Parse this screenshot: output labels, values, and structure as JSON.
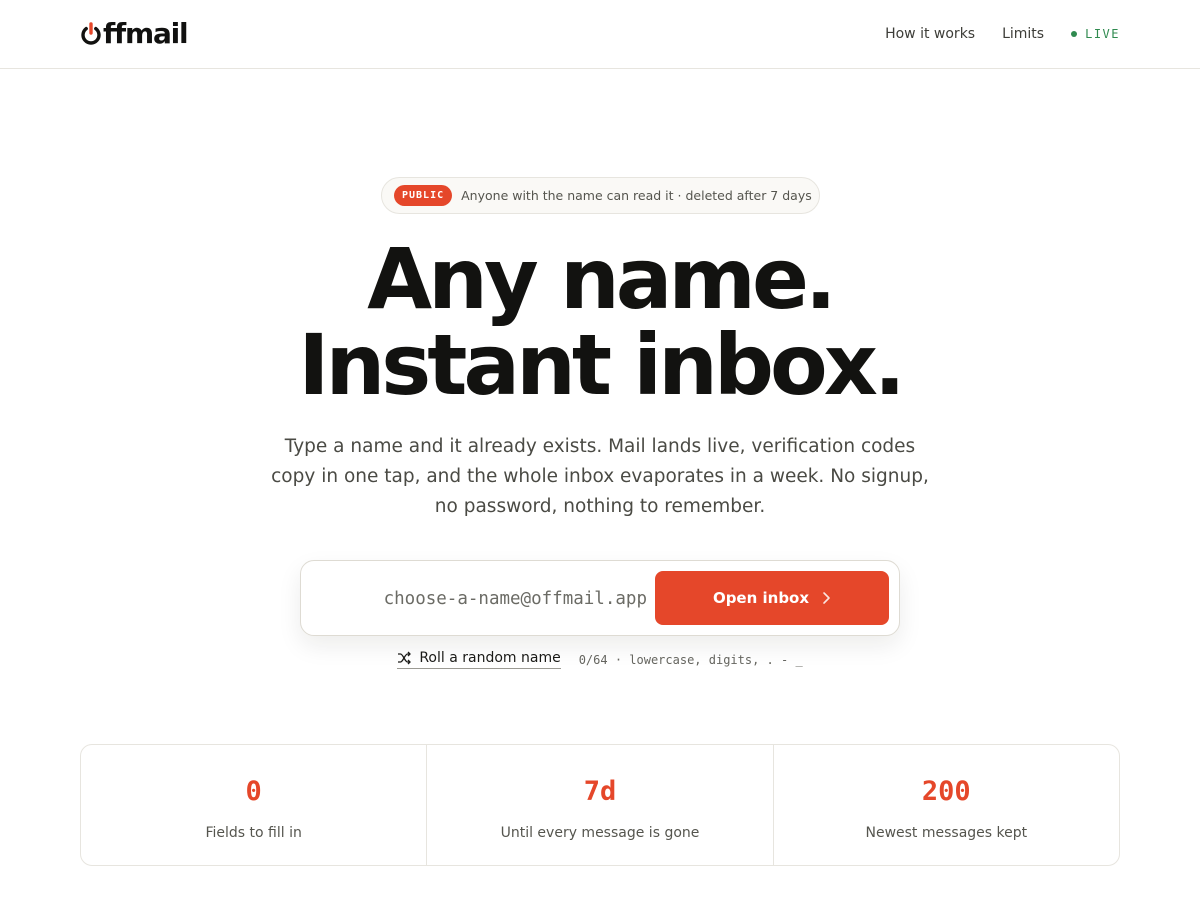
{
  "brand": {
    "name": "offmail",
    "accent": "#e5472a",
    "live_color": "#2f8a4f"
  },
  "nav": {
    "links": [
      {
        "label": "How it works"
      },
      {
        "label": "Limits"
      }
    ],
    "live": {
      "label": "LIVE",
      "icon": "status-dot-icon"
    }
  },
  "notice": {
    "tag": "PUBLIC",
    "text": "Anyone with the name can read it · deleted after 7 days"
  },
  "hero": {
    "line1": "Any name.",
    "line2": "Instant inbox.",
    "lede": "Type a name and it already exists. Mail lands live, verification codes copy in one tap, and the whole inbox evaporates in a week. No signup, no password, nothing to remember."
  },
  "form": {
    "value": "",
    "placeholder": "choose-a-name@offmail.app",
    "submit_label": "Open inbox",
    "submit_icon": "chevron-right-icon"
  },
  "helper": {
    "roll_label": "Roll a random name",
    "roll_icon": "shuffle-icon",
    "hint": "0/64 · lowercase, digits, . - _"
  },
  "stats": [
    {
      "value": "0",
      "label": "Fields to fill in"
    },
    {
      "value": "7d",
      "label": "Until every message is gone"
    },
    {
      "value": "200",
      "label": "Newest messages kept"
    }
  ]
}
